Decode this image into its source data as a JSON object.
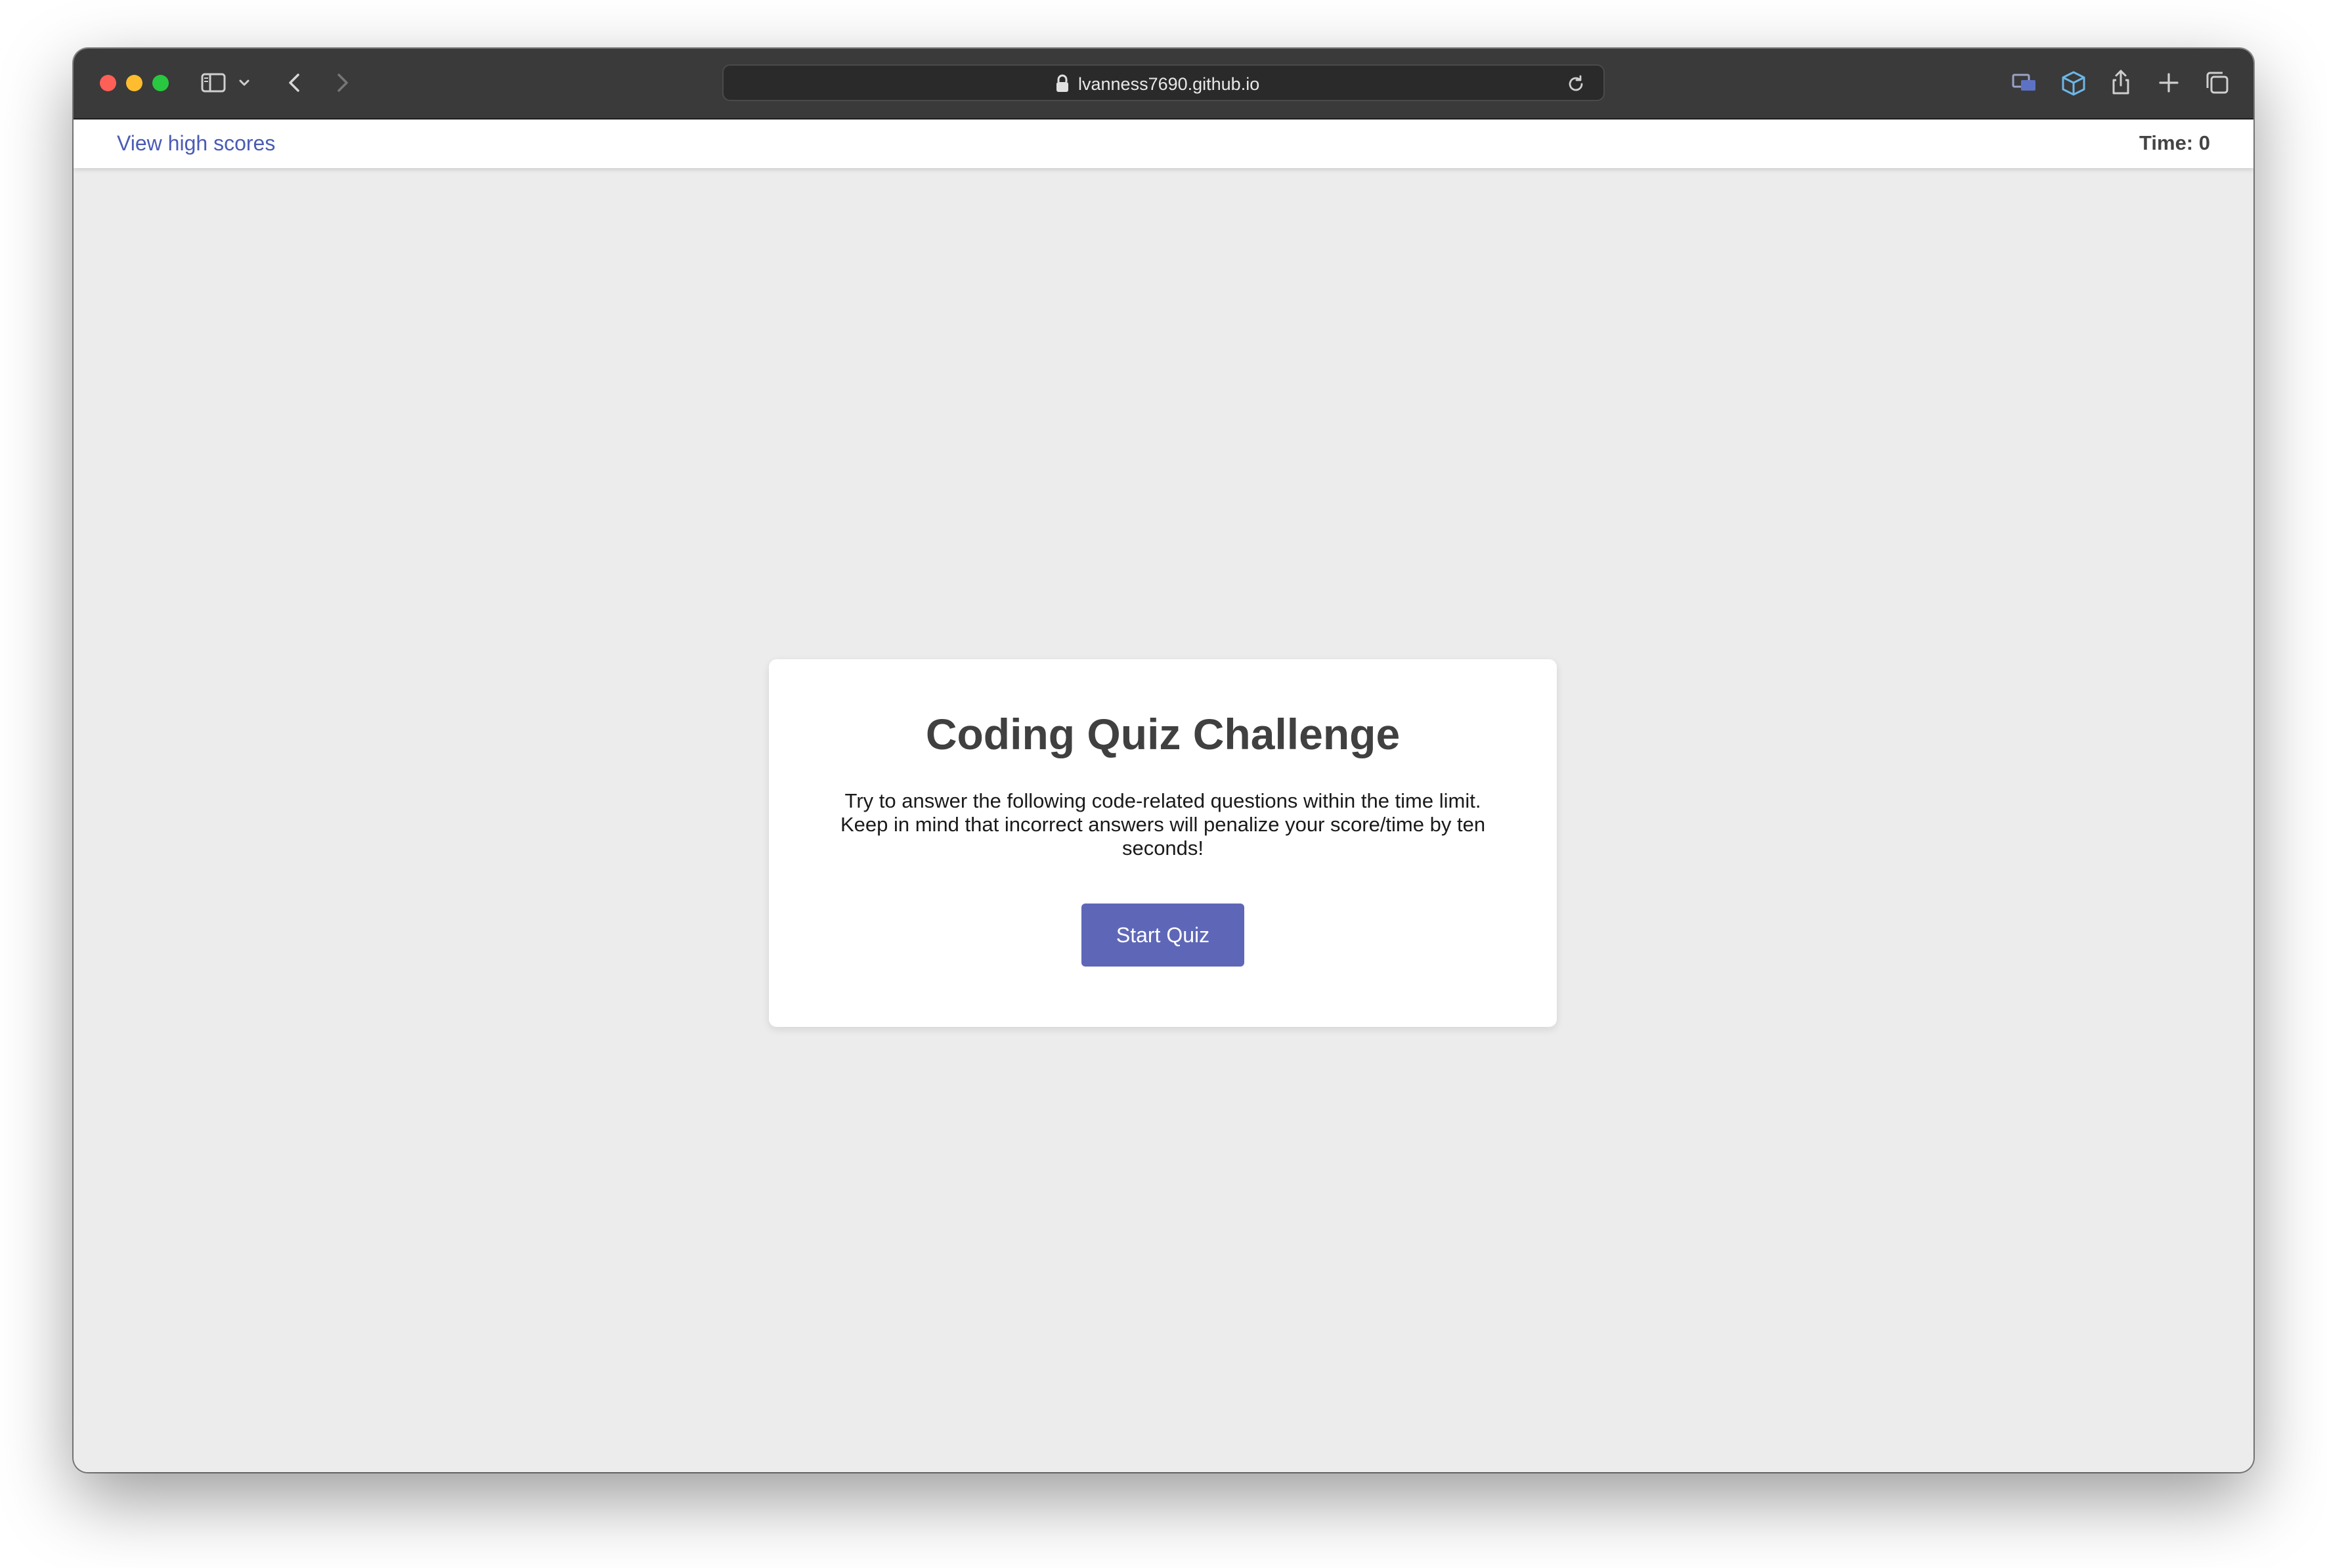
{
  "browser": {
    "url": "lvanness7690.github.io",
    "icons": [
      "sidebar-toggle-icon",
      "chevron-down-icon",
      "back-arrow-icon",
      "forward-arrow-icon",
      "lock-icon",
      "reload-icon",
      "screen-share-icon",
      "box-extension-icon",
      "share-icon",
      "new-tab-plus-icon",
      "tab-overview-icon"
    ]
  },
  "header": {
    "high_scores_label": "View high scores",
    "timer_label": "Time: 0"
  },
  "quiz": {
    "title": "Coding Quiz Challenge",
    "instructions": "Try to answer the following code-related questions within the time limit. Keep in mind that incorrect answers will penalize your score/time by ten seconds!",
    "start_button": "Start Quiz"
  },
  "colors": {
    "accent": "#5e67b7",
    "link": "#4b5bb5",
    "page_background": "#ececec"
  }
}
